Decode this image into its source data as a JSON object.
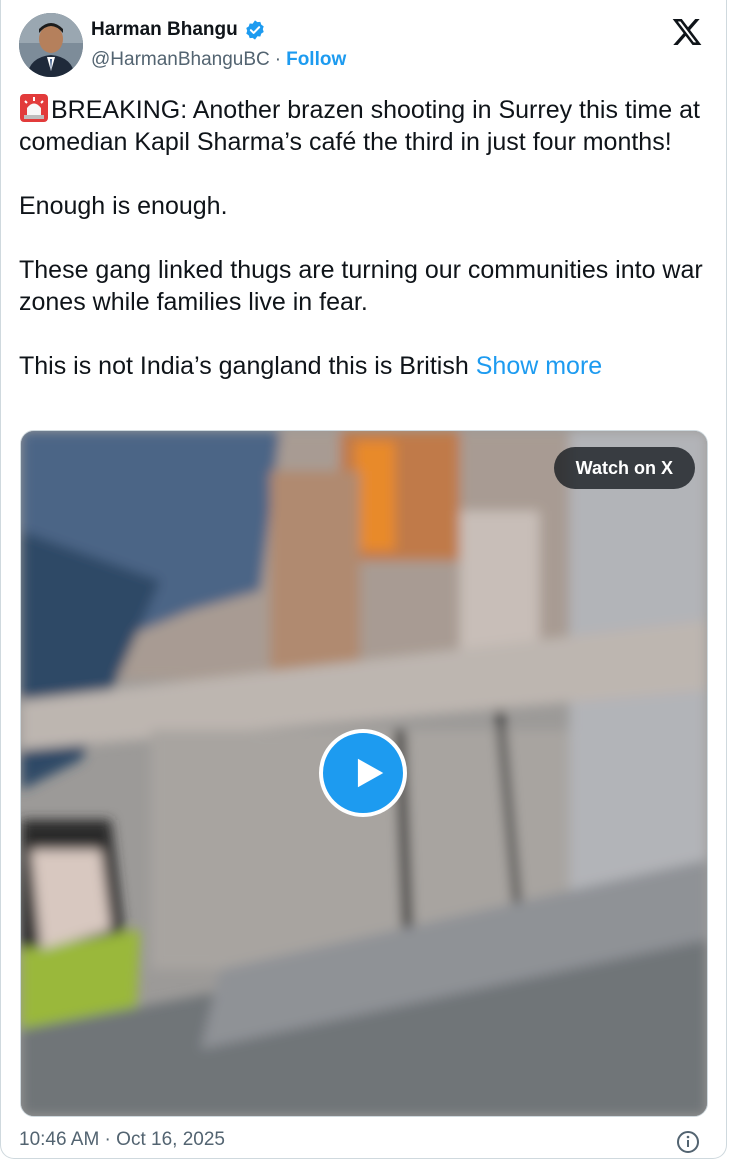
{
  "author": {
    "name": "Harman Bhangu",
    "handle": "@HarmanBhanguBC",
    "separator": "·",
    "follow_label": "Follow",
    "verified_icon": "verified-badge-icon"
  },
  "tweet": {
    "line1_emoji": "rotating-light-emoji",
    "paragraph1": "BREAKING: Another brazen shooting in Surrey this time at comedian Kapil Sharma’s café the third in just four months!",
    "paragraph2": "Enough is enough.",
    "paragraph3": "These gang linked thugs are turning our communities into war zones while families live in fear.",
    "paragraph4": "This is not India’s gangland this is British",
    "show_more": "Show more"
  },
  "media": {
    "watch_label": "Watch on X",
    "play_icon": "play-icon"
  },
  "footer": {
    "timestamp": "10:46 AM · Oct 16, 2025",
    "info_icon": "info-icon"
  },
  "colors": {
    "accent": "#1d9bf0",
    "text": "#0f1419",
    "secondary": "#536471"
  }
}
